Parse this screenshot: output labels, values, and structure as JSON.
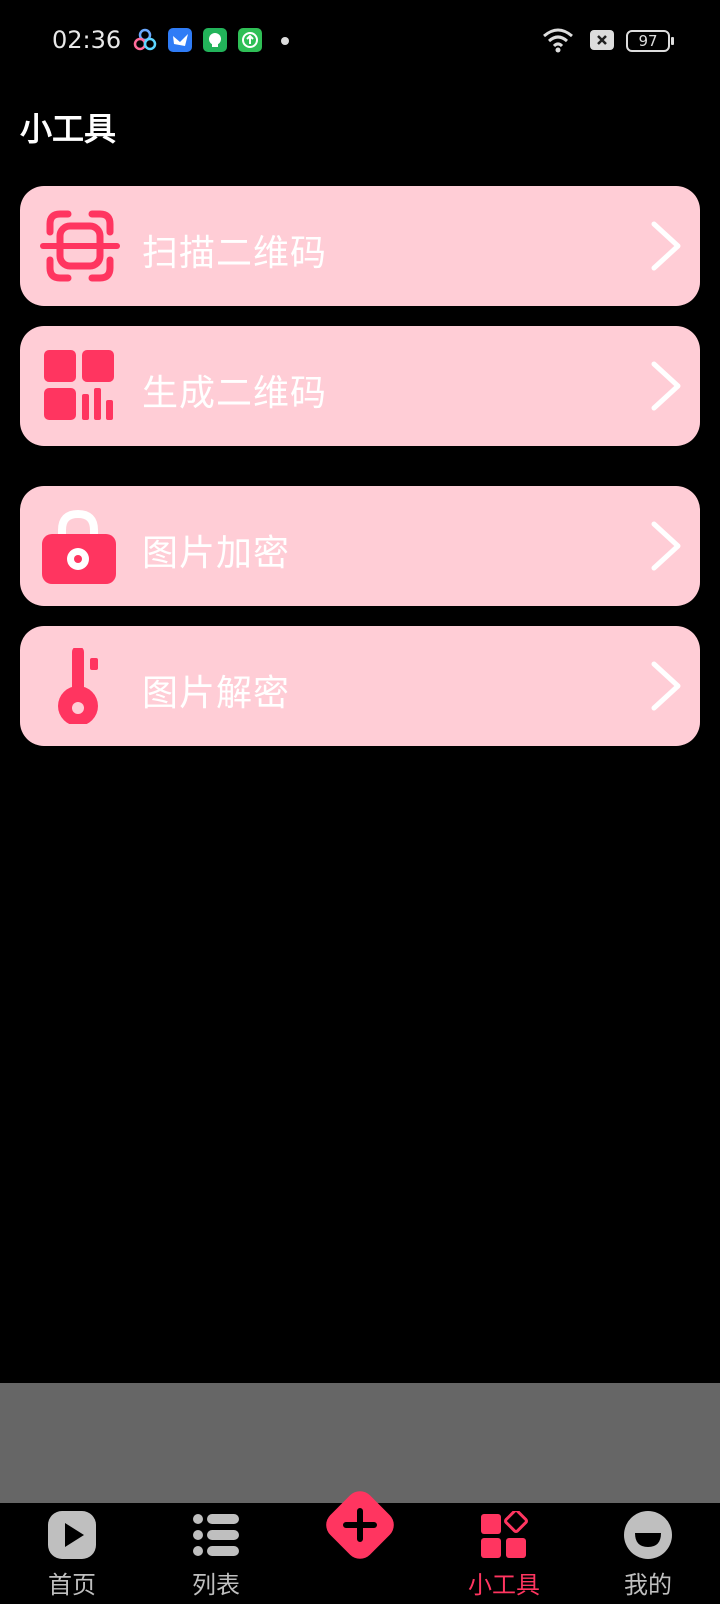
{
  "status_bar": {
    "time": "02:36",
    "battery": "97",
    "icons": [
      "network-app-icon",
      "feishu-icon",
      "messaging-icon",
      "upload-icon",
      "wifi-icon",
      "no-sim-icon",
      "battery-icon"
    ]
  },
  "page": {
    "title": "小工具"
  },
  "tools": [
    {
      "label": "扫描二维码",
      "icon": "scan-qr-icon"
    },
    {
      "label": "生成二维码",
      "icon": "qr-generate-icon"
    },
    {
      "label": "图片加密",
      "icon": "lock-icon"
    },
    {
      "label": "图片解密",
      "icon": "key-icon"
    }
  ],
  "bottom_nav": {
    "items": [
      {
        "label": "首页",
        "icon": "play-icon"
      },
      {
        "label": "列表",
        "icon": "list-icon"
      },
      {
        "label": "",
        "icon": "plus-icon"
      },
      {
        "label": "小工具",
        "icon": "tools-grid-icon",
        "active": true
      },
      {
        "label": "我的",
        "icon": "face-icon"
      }
    ]
  },
  "colors": {
    "accent": "#ff3560",
    "card_bg": "#ffcdd6",
    "background": "#000000",
    "gray_band": "#666666",
    "nav_inactive": "#bfbfbf"
  }
}
